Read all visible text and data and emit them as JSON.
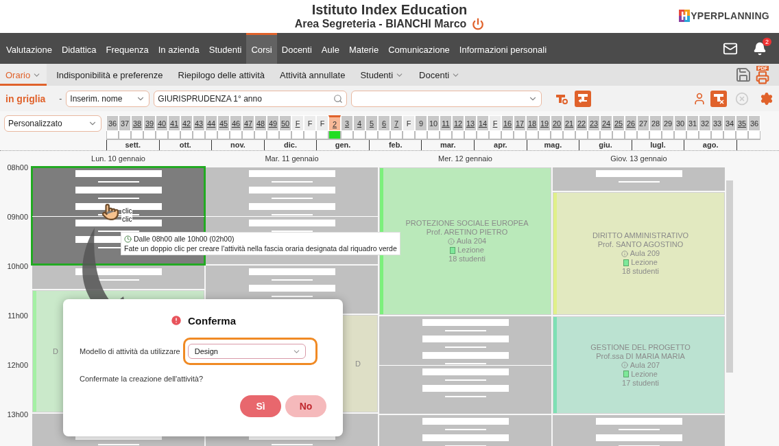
{
  "header": {
    "title": "Istituto Index Education",
    "subtitle": "Area Segreteria - BIANCHI Marco",
    "logo": "YPERPLANNING"
  },
  "main_nav": {
    "items": [
      {
        "label": "Valutazione",
        "selected": false
      },
      {
        "label": "Didattica",
        "selected": false
      },
      {
        "label": "Frequenza",
        "selected": false
      },
      {
        "label": "In azienda",
        "selected": false
      },
      {
        "label": "Studenti",
        "selected": false
      },
      {
        "label": "Corsi",
        "selected": true
      },
      {
        "label": "Docenti",
        "selected": false
      },
      {
        "label": "Aule",
        "selected": false
      },
      {
        "label": "Materie",
        "selected": false
      },
      {
        "label": "Comunicazione",
        "selected": false
      },
      {
        "label": "Informazioni personali",
        "selected": false
      }
    ],
    "notifications": "2"
  },
  "sub_nav": {
    "items": [
      {
        "label": "Orario",
        "selected": true,
        "dropdown": true
      },
      {
        "label": "Indisponibilità e preferenze",
        "selected": false,
        "dropdown": false
      },
      {
        "label": "Riepilogo delle attività",
        "selected": false,
        "dropdown": false
      },
      {
        "label": "Attività annullate",
        "selected": false,
        "dropdown": false
      },
      {
        "label": "Studenti",
        "selected": false,
        "dropdown": true
      },
      {
        "label": "Docenti",
        "selected": false,
        "dropdown": true
      }
    ],
    "pdf_label": "PDF"
  },
  "toolbar": {
    "mode": "in griglia",
    "separator": "-",
    "name_select": "Inserim. nome",
    "search_value": "GIURISPRUDENZA  1° anno",
    "close_disabled": true
  },
  "week_strip": {
    "period": "Personalizzato",
    "weeks": [
      {
        "label": "36",
        "kind": "week",
        "underlined": false,
        "selected": false
      },
      {
        "label": "37",
        "kind": "week",
        "underlined": false,
        "selected": false
      },
      {
        "label": "38",
        "kind": "week",
        "underlined": true,
        "selected": false
      },
      {
        "label": "39",
        "kind": "week",
        "underlined": true,
        "selected": false
      },
      {
        "label": "40",
        "kind": "week",
        "underlined": true,
        "selected": false
      },
      {
        "label": "41",
        "kind": "week",
        "underlined": true,
        "selected": false
      },
      {
        "label": "42",
        "kind": "week",
        "underlined": true,
        "selected": false
      },
      {
        "label": "43",
        "kind": "week",
        "underlined": true,
        "selected": false
      },
      {
        "label": "44",
        "kind": "week",
        "underlined": true,
        "selected": false
      },
      {
        "label": "45",
        "kind": "week",
        "underlined": true,
        "selected": false
      },
      {
        "label": "46",
        "kind": "week",
        "underlined": true,
        "selected": false
      },
      {
        "label": "47",
        "kind": "week",
        "underlined": true,
        "selected": false
      },
      {
        "label": "48",
        "kind": "week",
        "underlined": true,
        "selected": false
      },
      {
        "label": "49",
        "kind": "week",
        "underlined": true,
        "selected": false
      },
      {
        "label": "50",
        "kind": "week",
        "underlined": true,
        "selected": false
      },
      {
        "label": "F",
        "kind": "holiday",
        "underlined": true,
        "selected": false
      },
      {
        "label": "F",
        "kind": "holiday",
        "underlined": false,
        "selected": false
      },
      {
        "label": "F",
        "kind": "holiday",
        "underlined": false,
        "selected": false
      },
      {
        "label": "2",
        "kind": "week",
        "underlined": true,
        "selected": true
      },
      {
        "label": "3",
        "kind": "week",
        "underlined": true,
        "selected": false
      },
      {
        "label": "4",
        "kind": "week",
        "underlined": true,
        "selected": false
      },
      {
        "label": "5",
        "kind": "week",
        "underlined": true,
        "selected": false
      },
      {
        "label": "6",
        "kind": "week",
        "underlined": true,
        "selected": false
      },
      {
        "label": "7",
        "kind": "week",
        "underlined": true,
        "selected": false
      },
      {
        "label": "F",
        "kind": "holiday",
        "underlined": false,
        "selected": false
      },
      {
        "label": "9",
        "kind": "week",
        "underlined": false,
        "selected": false
      },
      {
        "label": "10",
        "kind": "week",
        "underlined": false,
        "selected": false
      },
      {
        "label": "11",
        "kind": "week",
        "underlined": true,
        "selected": false
      },
      {
        "label": "12",
        "kind": "week",
        "underlined": true,
        "selected": false
      },
      {
        "label": "13",
        "kind": "week",
        "underlined": true,
        "selected": false
      },
      {
        "label": "14",
        "kind": "week",
        "underlined": true,
        "selected": false
      },
      {
        "label": "F",
        "kind": "holiday",
        "underlined": true,
        "selected": false
      },
      {
        "label": "16",
        "kind": "week",
        "underlined": true,
        "selected": false
      },
      {
        "label": "17",
        "kind": "week",
        "underlined": true,
        "selected": false
      },
      {
        "label": "18",
        "kind": "week",
        "underlined": true,
        "selected": false
      },
      {
        "label": "19",
        "kind": "week",
        "underlined": true,
        "selected": false
      },
      {
        "label": "20",
        "kind": "week",
        "underlined": true,
        "selected": false
      },
      {
        "label": "21",
        "kind": "week",
        "underlined": true,
        "selected": false
      },
      {
        "label": "22",
        "kind": "week",
        "underlined": true,
        "selected": false
      },
      {
        "label": "23",
        "kind": "week",
        "underlined": true,
        "selected": false
      },
      {
        "label": "24",
        "kind": "week",
        "underlined": true,
        "selected": false
      },
      {
        "label": "25",
        "kind": "week",
        "underlined": true,
        "selected": false
      },
      {
        "label": "26",
        "kind": "week",
        "underlined": true,
        "selected": false
      },
      {
        "label": "27",
        "kind": "week",
        "underlined": false,
        "selected": false
      },
      {
        "label": "28",
        "kind": "week",
        "underlined": false,
        "selected": false
      },
      {
        "label": "29",
        "kind": "week",
        "underlined": false,
        "selected": false
      },
      {
        "label": "30",
        "kind": "week",
        "underlined": false,
        "selected": false
      },
      {
        "label": "31",
        "kind": "week",
        "underlined": false,
        "selected": false
      },
      {
        "label": "32",
        "kind": "week",
        "underlined": false,
        "selected": false
      },
      {
        "label": "33",
        "kind": "week",
        "underlined": false,
        "selected": false
      },
      {
        "label": "34",
        "kind": "week",
        "underlined": false,
        "selected": false
      },
      {
        "label": "35",
        "kind": "week",
        "underlined": true,
        "selected": false
      },
      {
        "label": "36",
        "kind": "week",
        "underlined": false,
        "selected": false
      }
    ],
    "months": [
      "sett.",
      "ott.",
      "nov.",
      "dic.",
      "gen.",
      "feb.",
      "mar.",
      "apr.",
      "mag.",
      "giu.",
      "lugl.",
      "ago."
    ]
  },
  "calendar": {
    "times": [
      "08h00",
      "09h00",
      "10h00",
      "11h00",
      "12h00",
      "13h00"
    ],
    "days": [
      {
        "label": "Lun. 10 gennaio",
        "blocks": [
          {
            "kind": "busy",
            "selected": true
          },
          {
            "kind": "busy",
            "selected": false
          },
          {
            "kind": "course",
            "color": "#a4f0a4",
            "lines": [
              "D"
            ]
          },
          {
            "kind": "busy",
            "selected": false
          }
        ]
      },
      {
        "label": "Mar. 11 gennaio",
        "blocks": [
          {
            "kind": "busy",
            "selected": false
          },
          {
            "kind": "busy",
            "selected": false
          },
          {
            "kind": "course",
            "lines": [
              "D"
            ]
          },
          {
            "kind": "busy",
            "selected": false
          }
        ]
      },
      {
        "label": "Mer. 12 gennaio",
        "blocks": [
          {
            "kind": "course",
            "color": "#7cf07c",
            "lines": [
              "PROTEZIONE SOCIALE EUROPEA",
              "Prof. ARETINO PIETRO"
            ],
            "room": "Aula 204",
            "type": "Lezione",
            "students": "18 studenti"
          },
          {
            "kind": "busy",
            "selected": false
          },
          {
            "kind": "busy",
            "selected": false
          }
        ]
      },
      {
        "label": "Giov. 13 gennaio",
        "blocks": [
          {
            "kind": "busy",
            "selected": false
          },
          {
            "kind": "course",
            "color": "#e0f08a",
            "lines": [
              "DIRITTO AMMINISTRATIVO",
              "Prof. SANTO AGOSTINO"
            ],
            "room": "Aula 209",
            "type": "Lezione",
            "students": "18 studenti"
          },
          {
            "kind": "course",
            "color": "#7ee0b4",
            "lines": [
              "GESTIONE DEL PROGETTO",
              "Prof.ssa DI MARIA MARIA"
            ],
            "room": "Aula 207",
            "type": "Lezione",
            "students": "17 studenti"
          },
          {
            "kind": "busy",
            "selected": false
          }
        ]
      }
    ]
  },
  "cursor": {
    "labels": [
      "clic",
      "clic"
    ]
  },
  "tooltip": {
    "time": "Dalle 08h00 alle 10h00 (02h00)",
    "text": "Fate un doppio clic per creare l'attività nella fascia oraria designata dal riquadro verde"
  },
  "dialog": {
    "title": "Conferma",
    "field_label": "Modello di attività da utilizzare",
    "field_value": "Design",
    "question": "Confermate la creazione dell'attività?",
    "buttons": [
      {
        "label": "Sì",
        "kind": "primary"
      },
      {
        "label": "No",
        "kind": "secondary"
      }
    ]
  }
}
